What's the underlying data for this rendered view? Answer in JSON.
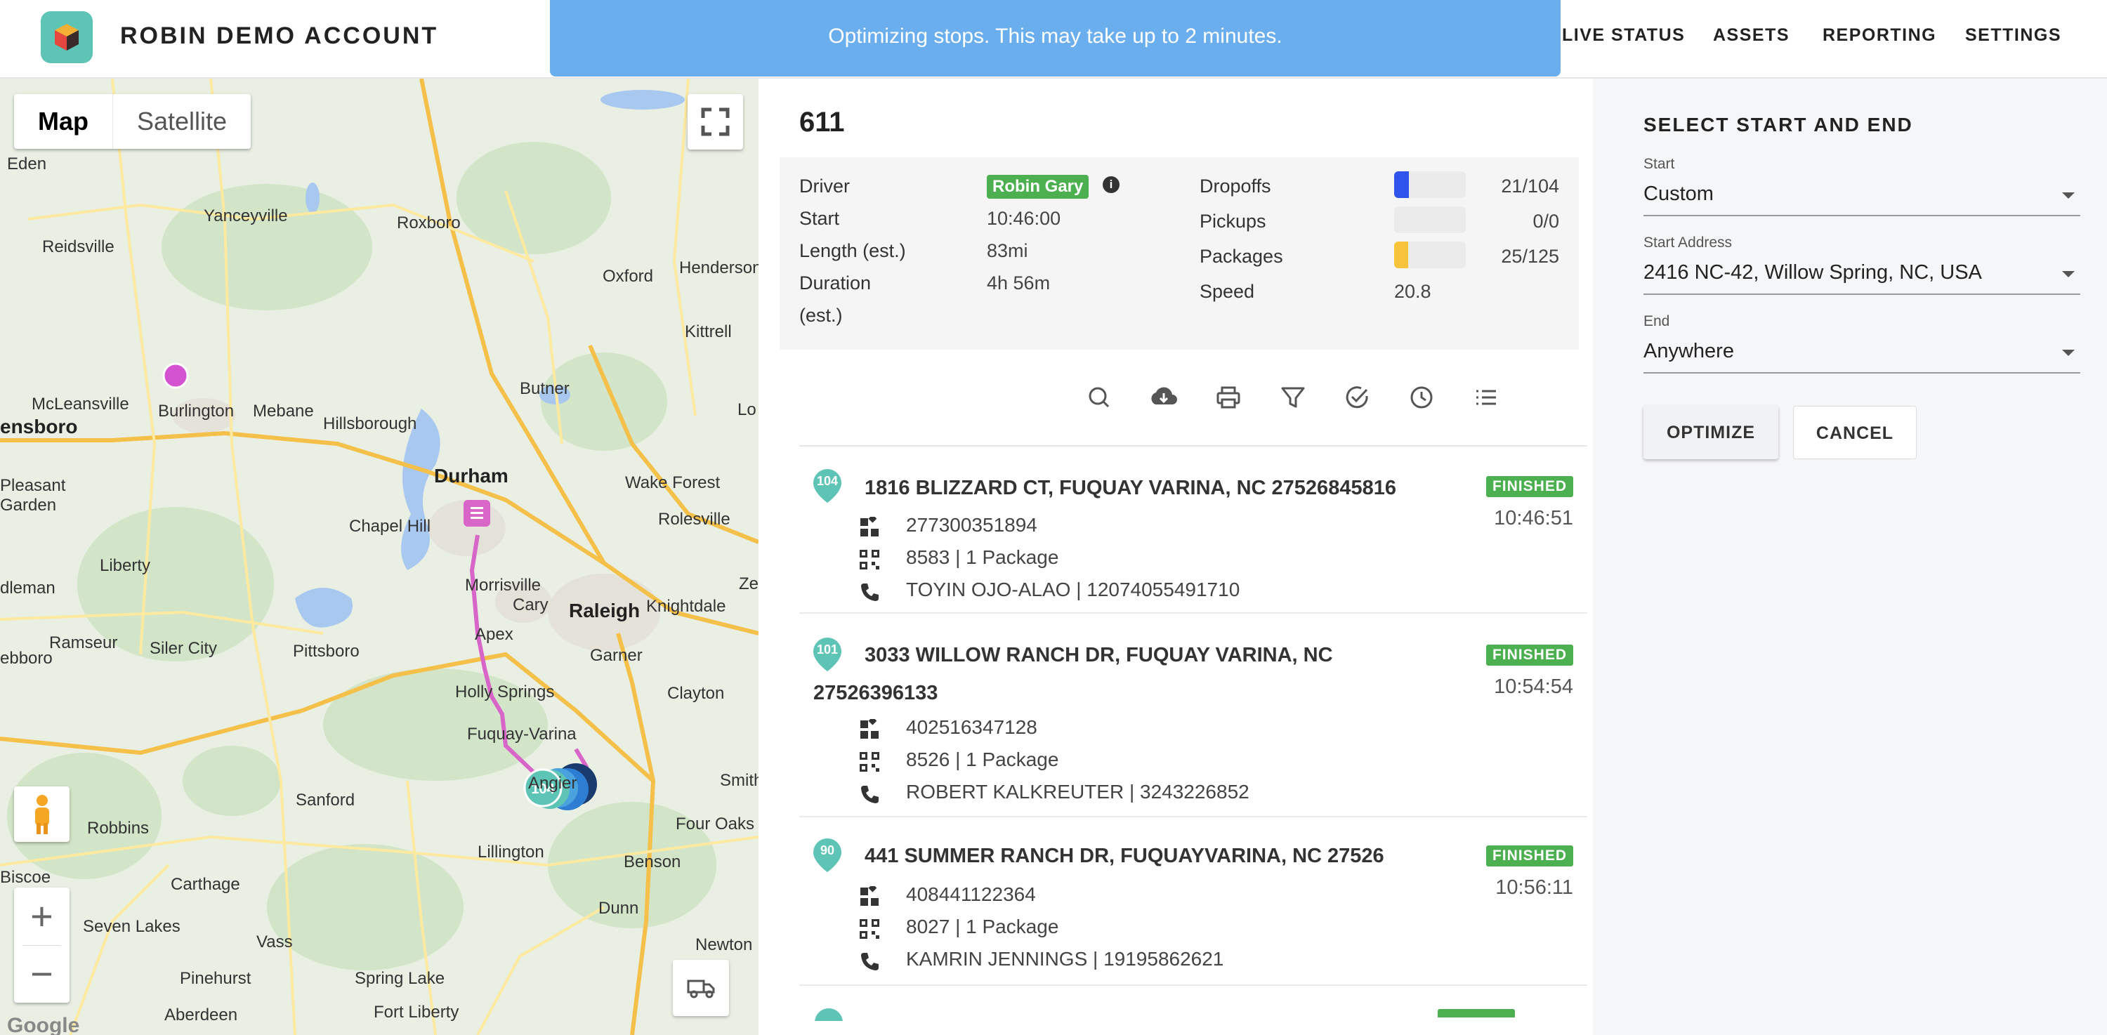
{
  "header": {
    "account_title": "ROBIN DEMO ACCOUNT",
    "nav": [
      {
        "label": "LIVE STATUS"
      },
      {
        "label": "ASSETS"
      },
      {
        "label": "REPORTING"
      },
      {
        "label": "SETTINGS"
      }
    ]
  },
  "toast": {
    "message": "Optimizing stops. This may take up to 2 minutes."
  },
  "map": {
    "type_options": {
      "map": "Map",
      "satellite": "Satellite"
    },
    "selected_type": "Map",
    "attribution": "Google",
    "places": [
      "Eden",
      "Yanceyville",
      "Roxboro",
      "Reidsville",
      "Oxford",
      "Henderson",
      "Kittrell",
      "McLeansville",
      "Burlington",
      "Mebane",
      "Butner",
      "ensboro",
      "Hillsborough",
      "Durham",
      "Wake Forest",
      "Pleasant",
      "Garden",
      "Chapel Hill",
      "Rolesville",
      "Liberty",
      "Morrisville",
      "Cary",
      "Raleigh",
      "Knightdale",
      "dleman",
      "Apex",
      "Ramseur",
      "Siler City",
      "Pittsboro",
      "Garner",
      "Holly Springs",
      "Clayton",
      "Fuquay-Varina",
      "Angier",
      "Sanford",
      "Smith",
      "Robbins",
      "Four Oaks",
      "Lillington",
      "Benson",
      "Carthage",
      "Biscoe",
      "Dunn",
      "Seven Lakes",
      "Vass",
      "Newton",
      "Pinehurst",
      "Spring Lake",
      "Aberdeen",
      "Fort Liberty",
      "Eden",
      "Lo",
      "Ze",
      "ebboro"
    ],
    "route_markers": [
      "104"
    ],
    "colors": {
      "route": "#d865c8",
      "pin_teal": "#5ec4b6",
      "pin_blue": "#2d7dd2"
    }
  },
  "route": {
    "title": "611",
    "summary": {
      "driver_label": "Driver",
      "driver_name": "Robin Gary",
      "start_label": "Start",
      "start_value": "10:46:00",
      "length_label": "Length (est.)",
      "length_value": "83mi",
      "duration_label_1": "Duration",
      "duration_label_2": "(est.)",
      "duration_value": "4h 56m",
      "dropoffs_label": "Dropoffs",
      "dropoffs_value": "21/104",
      "dropoffs_progress": 0.2019,
      "dropoffs_color": "#2f54eb",
      "pickups_label": "Pickups",
      "pickups_value": "0/0",
      "pickups_progress": 0,
      "packages_label": "Packages",
      "packages_value": "25/125",
      "packages_progress": 0.2,
      "packages_color": "#f7c33b",
      "speed_label": "Speed",
      "speed_value": "20.8"
    },
    "toolbar": [
      "search-icon",
      "cloud-download-icon",
      "print-icon",
      "filter-icon",
      "check-circle-icon",
      "clock-icon",
      "list-icon"
    ],
    "stops": [
      {
        "number": "104",
        "address": "1816 BLIZZARD CT, FUQUAY VARINA, NC 27526845816",
        "status": "FINISHED",
        "time": "10:46:51",
        "id": "277300351894",
        "packages": "8583 | 1 Package",
        "contact": "TOYIN OJO-ALAO | 12074055491710"
      },
      {
        "number": "101",
        "address": "3033 WILLOW RANCH DR, FUQUAY VARINA, NC 27526396133",
        "status": "FINISHED",
        "time": "10:54:54",
        "id": "402516347128",
        "packages": "8526 | 1 Package",
        "contact": "ROBERT KALKREUTER | 3243226852"
      },
      {
        "number": "90",
        "address": "441 SUMMER RANCH DR, FUQUAYVARINA, NC 27526",
        "status": "FINISHED",
        "time": "10:56:11",
        "id": "408441122364",
        "packages": "8027 | 1 Package",
        "contact": "KAMRIN JENNINGS | 19195862621"
      }
    ]
  },
  "start_end": {
    "title": "SELECT START AND END",
    "start_label": "Start",
    "start_value": "Custom",
    "start_address_label": "Start Address",
    "start_address_value": "2416 NC-42, Willow Spring, NC, USA",
    "end_label": "End",
    "end_value": "Anywhere",
    "optimize_label": "OPTIMIZE",
    "cancel_label": "CANCEL"
  }
}
